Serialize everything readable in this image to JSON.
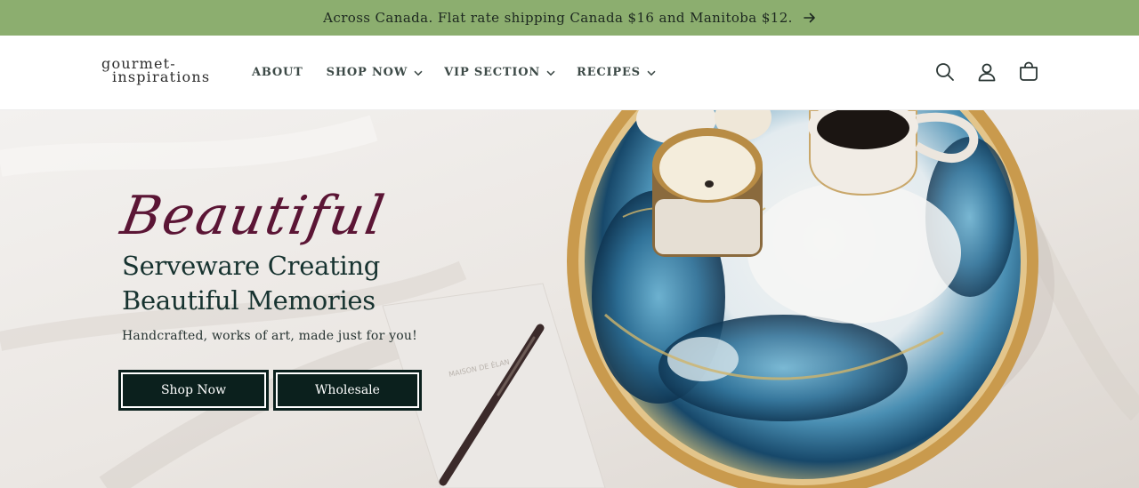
{
  "announcement": {
    "text": "Across Canada. Flat rate shipping Canada $16 and Manitoba $12.",
    "icon": "arrow-right-icon"
  },
  "header": {
    "logo_line1": "gourmet-",
    "logo_line2": "inspirations",
    "nav": [
      {
        "label": "ABOUT",
        "has_dropdown": false
      },
      {
        "label": "SHOP NOW",
        "has_dropdown": true
      },
      {
        "label": "VIP SECTION",
        "has_dropdown": true
      },
      {
        "label": "RECIPES",
        "has_dropdown": true
      }
    ],
    "icons": [
      "search-icon",
      "account-icon",
      "cart-icon"
    ]
  },
  "hero": {
    "script_title": "Beautiful",
    "headline_line1": "Serveware Creating",
    "headline_line2": "Beautiful Memories",
    "subtext": "Handcrafted, works of art, made just for you!",
    "buttons": {
      "primary": "Shop Now",
      "secondary": "Wholesale"
    }
  },
  "colors": {
    "announcement_bg": "#8cae6f",
    "button_bg": "#0b201d",
    "script_color": "#5b1535",
    "heading_color": "#173330"
  }
}
